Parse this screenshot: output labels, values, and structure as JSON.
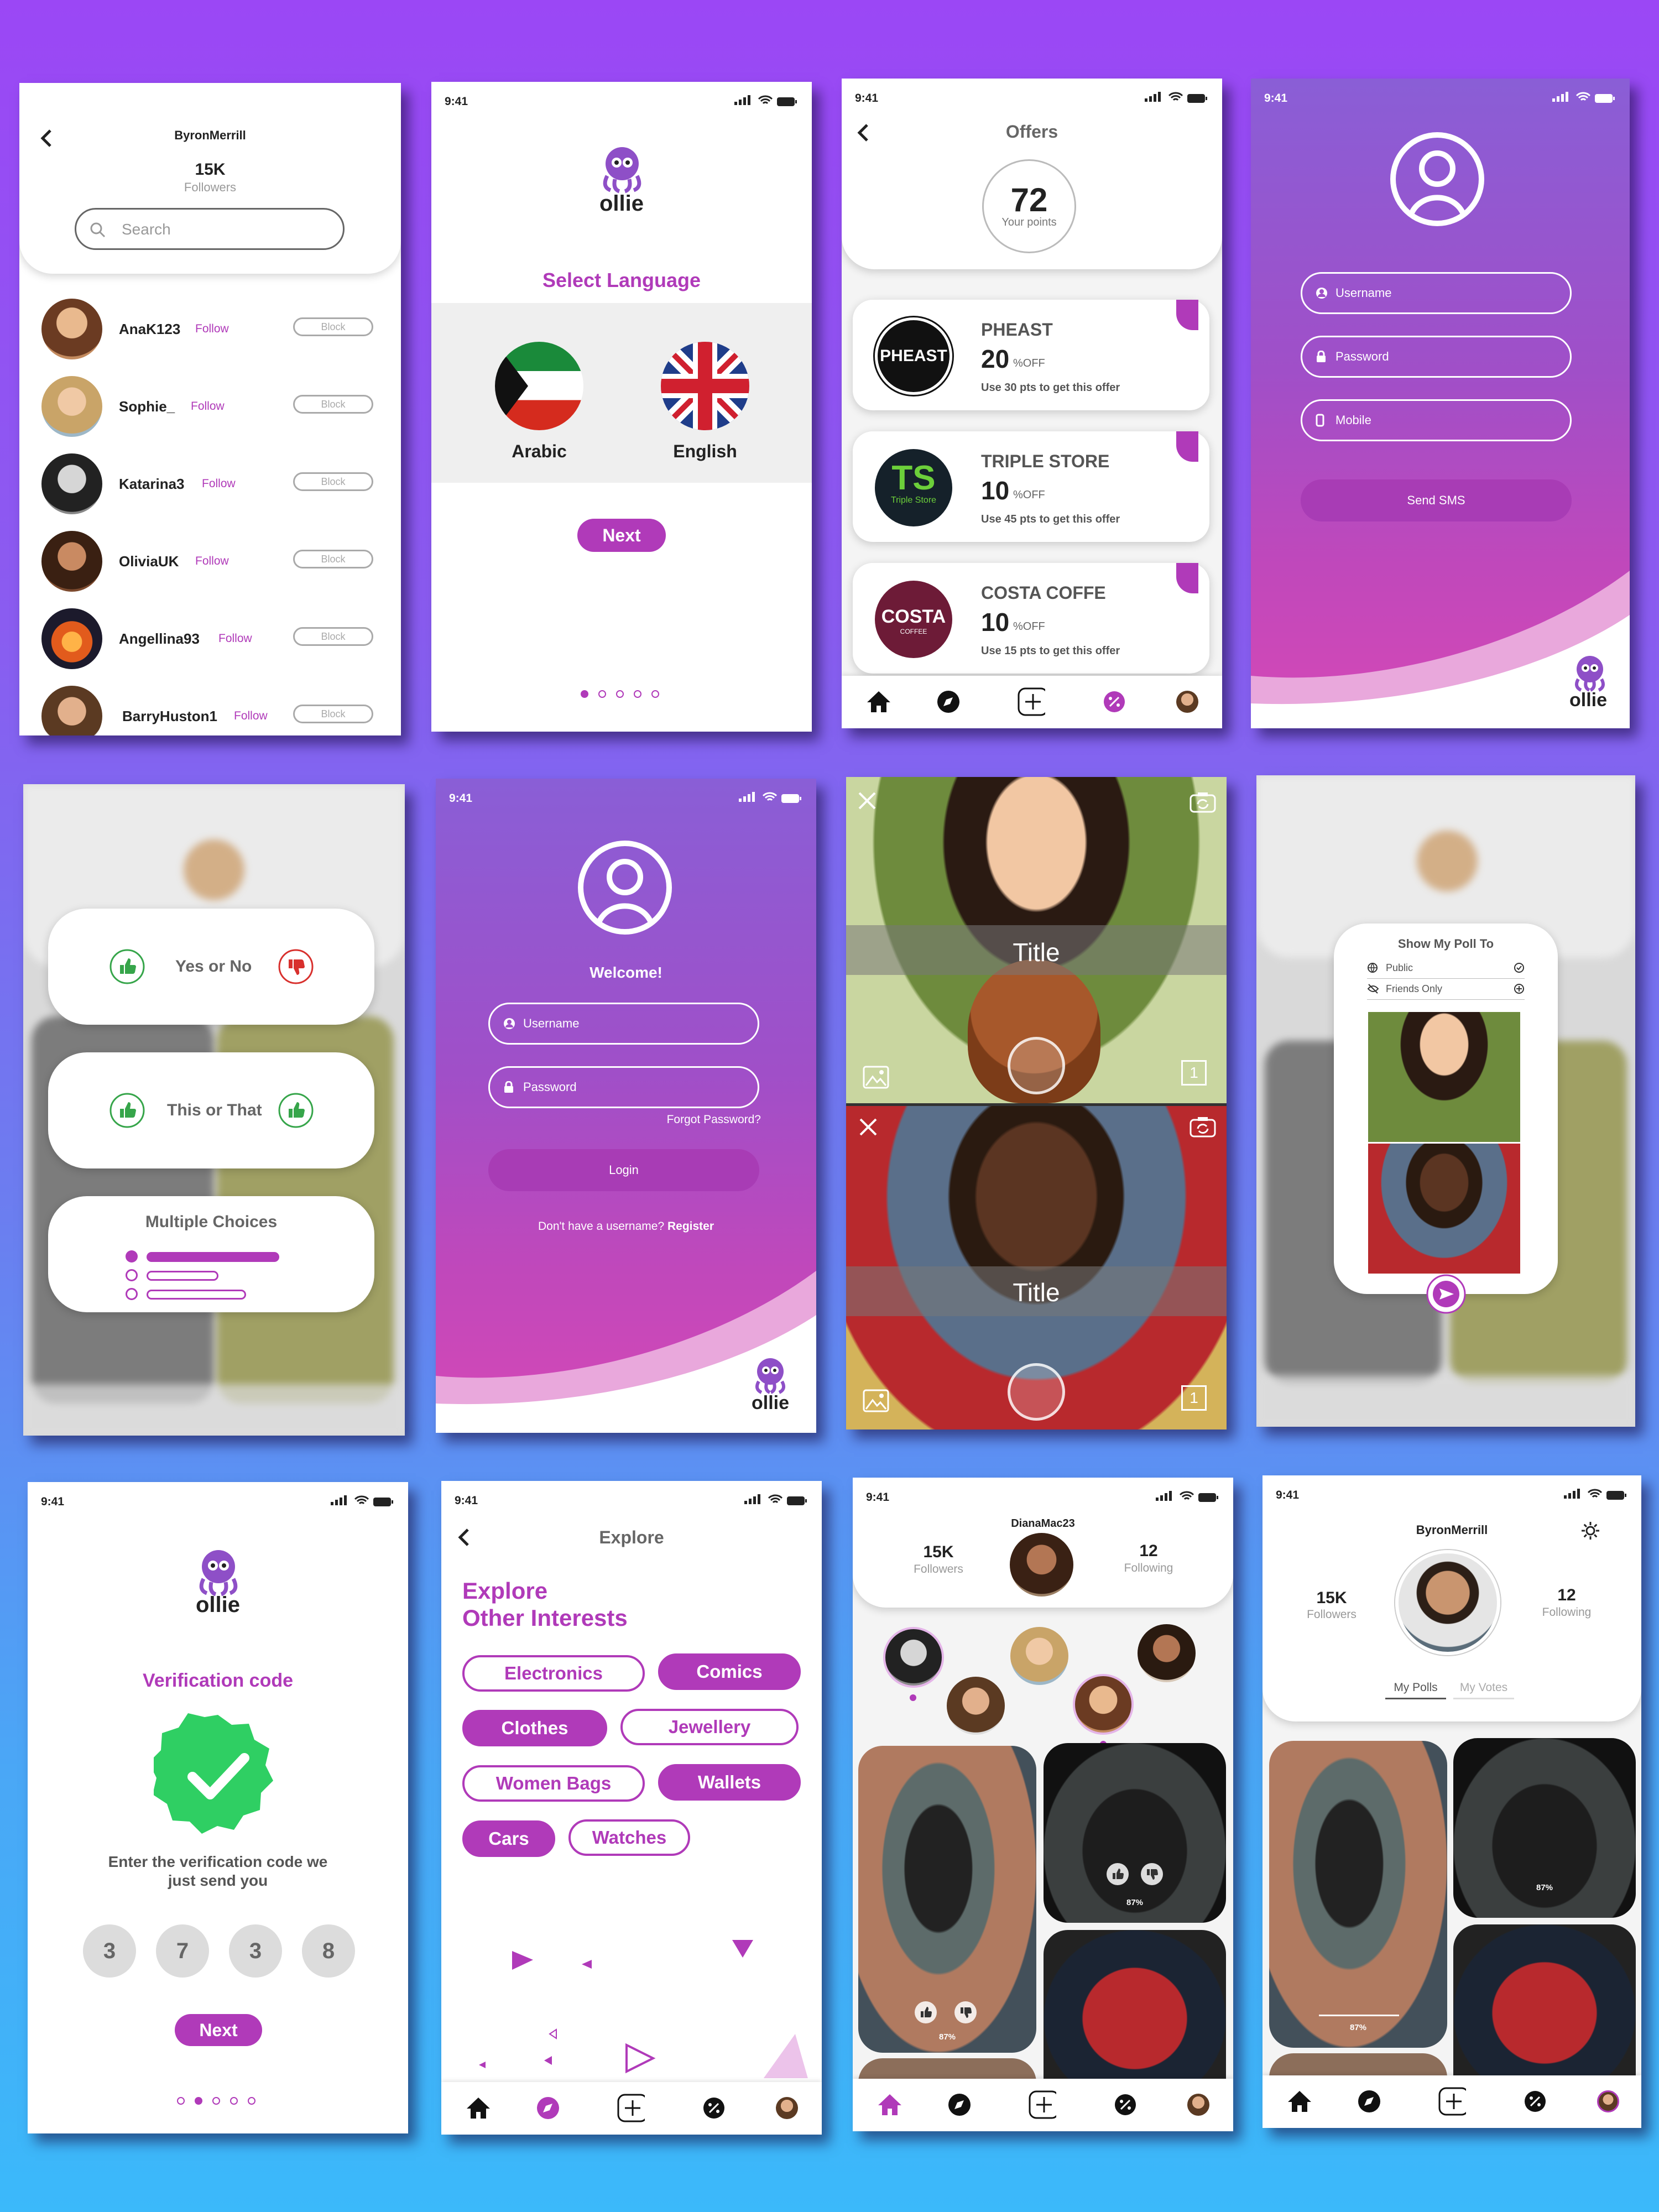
{
  "status_time": "9:41",
  "follow_screen": {
    "username": "ByronMerrill",
    "count": "15K",
    "count_label": "Followers",
    "search_placeholder": "Search",
    "follow_label": "Follow",
    "block_label": "Block",
    "users": [
      "AnaK123",
      "Sophie_",
      "Katarina3",
      "OliviaUK",
      "Angellina93",
      "BarryHuston1"
    ]
  },
  "language_screen": {
    "logo": "ollie",
    "heading": "Select Language",
    "languages": [
      "Arabic",
      "English"
    ],
    "next_label": "Next"
  },
  "offers_screen": {
    "title": "Offers",
    "points": "72",
    "points_label": "Your points",
    "percent_suffix": "%OFF",
    "offers": [
      {
        "name": "PHEAST",
        "logo_text": "PHEAST",
        "discount": "20",
        "note": "Use 30 pts to get this offer"
      },
      {
        "name": "TRIPLE STORE",
        "logo_text": "TS",
        "logo_sub": "Triple Store",
        "discount": "10",
        "note": "Use 45 pts to get this offer"
      },
      {
        "name": "COSTA COFFE",
        "logo_text": "COSTA",
        "logo_sub": "COFFEE",
        "discount": "10",
        "note": "Use 15 pts to get this offer"
      }
    ]
  },
  "sms_screen": {
    "username_ph": "Username",
    "password_ph": "Password",
    "mobile_ph": "Mobile",
    "button": "Send SMS",
    "logo": "ollie"
  },
  "poll_type_screen": {
    "options": [
      "Yes or No",
      "This or That",
      "Multiple Choices"
    ]
  },
  "login_screen": {
    "welcome": "Welcome!",
    "username_ph": "Username",
    "password_ph": "Password",
    "forgot": "Forgot Password?",
    "login": "Login",
    "no_account": "Don't have a username?",
    "register": "Register",
    "logo": "ollie"
  },
  "camera_screen": {
    "title_top": "Title",
    "title_bottom": "Title",
    "count_top": "1",
    "count_bottom": "1"
  },
  "share_screen": {
    "title": "Show My Poll To",
    "options": [
      "Public",
      "Friends Only"
    ]
  },
  "verify_screen": {
    "logo": "ollie",
    "heading": "Verification code",
    "message": "Enter the verification code we just send you",
    "digits": [
      "3",
      "7",
      "3",
      "8"
    ],
    "next_label": "Next"
  },
  "explore_screen": {
    "title": "Explore",
    "heading_line1": "Explore",
    "heading_line2": "Other Interests",
    "categories": [
      {
        "label": "Electronics",
        "selected": false
      },
      {
        "label": "Comics",
        "selected": true
      },
      {
        "label": "Clothes",
        "selected": true
      },
      {
        "label": "Jewellery",
        "selected": false
      },
      {
        "label": "Women Bags",
        "selected": false
      },
      {
        "label": "Wallets",
        "selected": true
      },
      {
        "label": "Cars",
        "selected": true
      },
      {
        "label": "Watches",
        "selected": false
      }
    ]
  },
  "feed_screen": {
    "username": "DianaMac23",
    "followers": "15K",
    "followers_label": "Followers",
    "following": "12",
    "following_label": "Following",
    "vote_a": "87%",
    "vote_b": "87%"
  },
  "profile_screen": {
    "username": "ByronMerrill",
    "followers": "15K",
    "followers_label": "Followers",
    "following": "12",
    "following_label": "Following",
    "tabs": [
      "My Polls",
      "My Votes"
    ],
    "vote_a": "87%",
    "vote_b": "87%"
  }
}
